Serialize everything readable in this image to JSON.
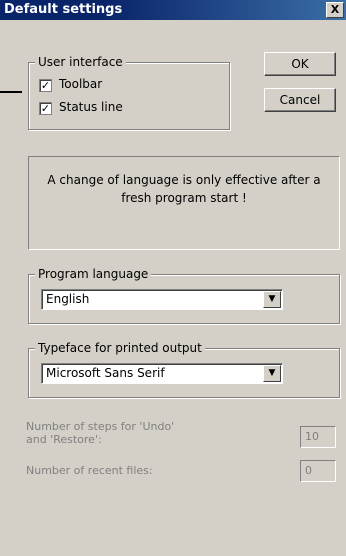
{
  "window": {
    "title": "Default settings",
    "close_label": "X"
  },
  "user_interface": {
    "group_label": "User interface",
    "toolbar": {
      "label": "Toolbar",
      "checked": true
    },
    "status_line": {
      "label": "Status line",
      "checked": true
    }
  },
  "buttons": {
    "ok": "OK",
    "cancel": "Cancel"
  },
  "notice": "A change of language is only effective after a fresh program start !",
  "program_language": {
    "group_label": "Program language",
    "value": "English"
  },
  "typeface": {
    "group_label": "Typeface for printed output",
    "value": "Microsoft Sans Serif"
  },
  "undo_steps": {
    "label": "Number of steps for 'Undo' and 'Restore':",
    "value": "10"
  },
  "recent_files": {
    "label": "Number of recent files:",
    "value": "0"
  },
  "checkmark": "✓",
  "dropdown_arrow": "▼"
}
